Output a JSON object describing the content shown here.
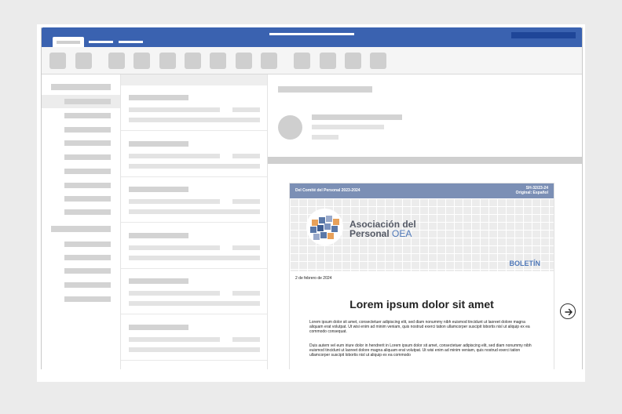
{
  "document": {
    "header_left": "Del Comité del Personal 2023-2024",
    "header_code": "SH-32/23-24",
    "header_lang": "Original: Español",
    "org_line1": "Asociación del",
    "org_line2_a": "Personal ",
    "org_line2_b": "OEA",
    "section": "BOLETÍN",
    "date": "2 de febrero de 2024",
    "title": "Lorem ipsum dolor sit amet",
    "paragraph1": "Lorem ipsum dolor sit amet, consectetuer adipiscing elit, sed diam nonummy nibh euismod tincidunt ut laoreet dolore magna aliquam erat volutpat. Ut wisi enim ad minim veniam, quis nostrud exerci tation ullamcorper suscipit lobortis nisl ut aliquip ex ea commodo consequat.",
    "paragraph2": "Duis autem vel eum iriure dolor in hendrerit in Lorem ipsum dolor sit amet, consectetuer adipiscing elit, sed diam nonummy nibh euismod tincidunt ut laoreet dolore magna aliquam erat volutpat. Ut wisi enim ad minim veniam, quis nostrud exerci tation ullamcorper suscipit lobortis nisl ut aliquip ex ea commodo"
  },
  "colors": {
    "titlebar": "#3a62b0",
    "doc_header": "#7b8fb5",
    "accent": "#4f78b8",
    "logo_orange": "#e8a15a",
    "logo_blue": "#5a78a8"
  },
  "icons": {
    "next": "arrow-right-circle-icon"
  }
}
